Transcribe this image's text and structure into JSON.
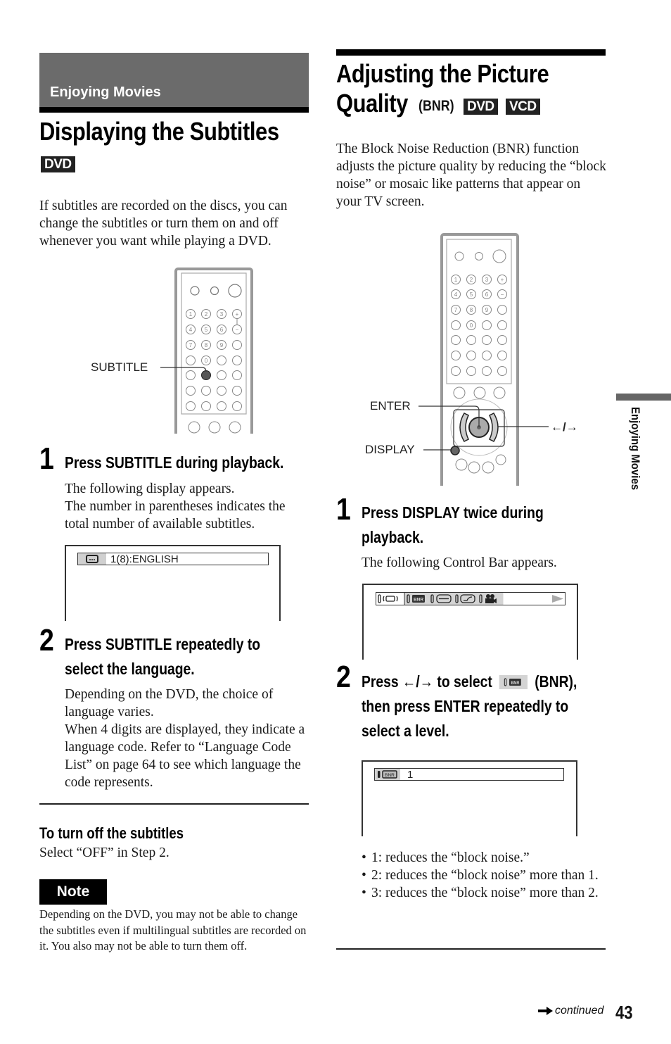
{
  "section": {
    "label": "Enjoying Movies"
  },
  "side_tab": {
    "label": "Enjoying Movies"
  },
  "left": {
    "title": "Displaying the Subtitles",
    "badge": "DVD",
    "intro": "If subtitles are recorded on the discs, you can change the subtitles or turn them on and off whenever you want while playing a DVD.",
    "remote_callout": "SUBTITLE",
    "steps": [
      {
        "number": "1",
        "heading": "Press SUBTITLE during playback.",
        "body_lines": [
          "The following display appears.",
          "The number in parentheses indicates the total number of available subtitles."
        ]
      },
      {
        "number": "2",
        "heading_lines": [
          "Press SUBTITLE repeatedly to",
          "select the language."
        ],
        "body_lines": [
          "Depending on the DVD, the choice of language varies.",
          "When 4 digits are displayed, they indicate a language code. Refer to “Language Code List” on page 64 to see which language the code represents."
        ]
      }
    ],
    "osd_text": "1(8):ENGLISH",
    "turn_off": {
      "heading": "To turn off the subtitles",
      "text": "Select “OFF” in Step 2."
    },
    "note": {
      "label": "Note",
      "text": "Depending on the DVD, you may not be able to change the subtitles even if multilingual subtitles are recorded on it. You also may not be able to turn them off."
    }
  },
  "right": {
    "title_line1": "Adjusting the Picture",
    "title_line2": "Quality",
    "title_suffix": "(BNR)",
    "badges": [
      "DVD",
      "VCD"
    ],
    "intro": "The Block Noise Reduction (BNR) function adjusts the picture quality by reducing the “block noise” or mosaic like patterns that appear on your TV screen.",
    "remote_callouts": {
      "enter": "ENTER",
      "display": "DISPLAY",
      "arrows": "←/→"
    },
    "steps": [
      {
        "number": "1",
        "heading_lines": [
          "Press DISPLAY twice during",
          "playback."
        ],
        "body": "The following Control Bar appears."
      },
      {
        "number": "2",
        "heading_part1": "Press ←/→ to select",
        "heading_part2": "(BNR),",
        "heading_lines": [
          "then press ENTER repeatedly to",
          "select a level."
        ]
      }
    ],
    "control_bar": {
      "icons": [
        "surround-icon",
        "bnr-icon",
        "sharpness-icon",
        "gamma-icon",
        "angle-camera-icon"
      ],
      "bnr_label": "BNR"
    },
    "bnr_osd": {
      "label": "BNR",
      "value": "1"
    },
    "levels": [
      "1: reduces the “block noise.”",
      "2: reduces the “block noise” more than 1.",
      "3: reduces the “block noise” more than 2."
    ]
  },
  "footer": {
    "continued": "continued",
    "page_number": "43"
  }
}
